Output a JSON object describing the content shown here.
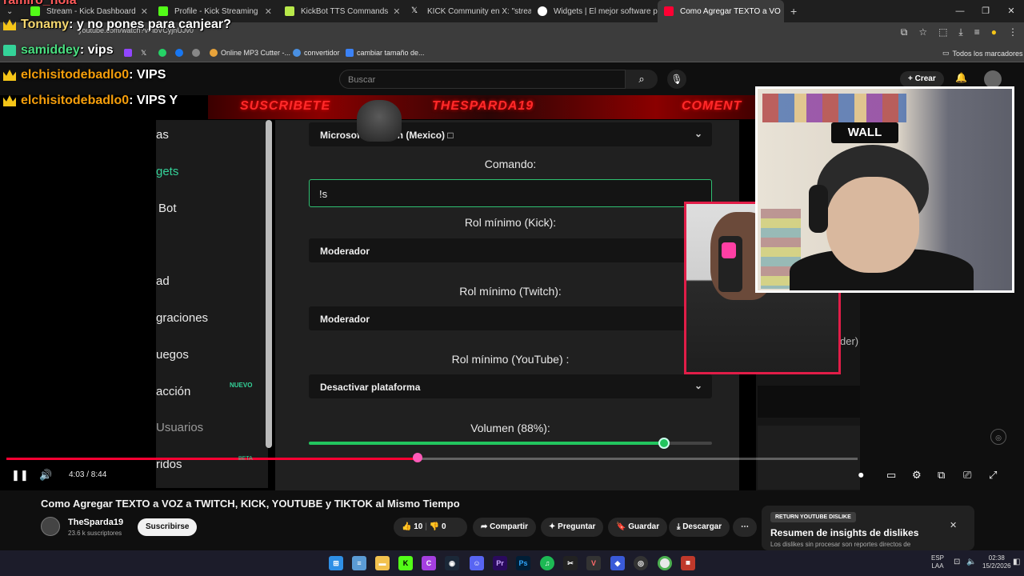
{
  "browser": {
    "tabs": [
      {
        "label": "Stream - Kick Dashboard",
        "color": "#53fc18"
      },
      {
        "label": "Profile - Kick Streaming",
        "color": "#53fc18"
      },
      {
        "label": "KickBot TTS Commands",
        "color": "#b8e94a"
      },
      {
        "label": "KICK Community en X: \"stream",
        "color": "#ffffff"
      },
      {
        "label": "Widgets | El mejor software pa",
        "color": "#ffffff"
      },
      {
        "label": "Como Agregar TEXTO a VO",
        "color": "#ff0033"
      }
    ],
    "url": "youtube.com/watch?v=lbVCyjhUJv0",
    "bookmarks": {
      "mp3": "Online MP3 Cutter -...",
      "convertidor": "convertidor",
      "resize": "cambiar tamaño de...",
      "all": "Todos los marcadores"
    }
  },
  "yt_header": {
    "search_placeholder": "Buscar",
    "create": "Crear"
  },
  "chat": [
    {
      "user": "ramiro_hola",
      "message": ""
    },
    {
      "user": "Tonamy",
      "message": ": y no pones para canjear?"
    },
    {
      "user": "samiddey",
      "message": ": vips"
    },
    {
      "user": "elchisitodebadlo0",
      "message": ": VIPS"
    },
    {
      "user": "elchisitodebadlo0",
      "message": ": VIPS Y"
    }
  ],
  "banner": {
    "left": "SUSCRIBETE",
    "center": "THESPARDA19",
    "right": "COMENT"
  },
  "sidebar": {
    "items": [
      "as",
      "gets",
      "Bot",
      "ad",
      "graciones",
      "uegos",
      "acción",
      "Usuarios",
      "ridos"
    ],
    "nuevo": "NUEVO",
    "beta": "BETA"
  },
  "form": {
    "voice": "Microsoft           Spanish (Mexico) □",
    "command_label": "Comando:",
    "command_value": "!s",
    "rol_kick_label": "Rol mínimo (Kick):",
    "rol_kick_value": "Moderador",
    "rol_twitch_label": "Rol mínimo (Twitch):",
    "rol_twitch_value": "Moderador",
    "rol_youtube_label": "Rol mínimo (YouTube) :",
    "rol_youtube_value": "Desactivar plataforma",
    "volume_label": "Volumen (88%):",
    "volume": 0.88
  },
  "cam": {
    "wall_text": "WALL"
  },
  "right_panel": {
    "der": "der)"
  },
  "player": {
    "time": "4:03 / 8:44",
    "progress": 0.483
  },
  "video_info": {
    "title": "Como Agregar TEXTO a VOZ a TWITCH, KICK, YOUTUBE y TIKTOK al Mismo Tiempo",
    "channel": "TheSparda19",
    "subscribers": "23.6 k suscriptores",
    "subscribe": "Suscribirse",
    "likes": "10",
    "dislikes": "0",
    "share": "Compartir",
    "ask": "Preguntar",
    "save": "Guardar",
    "download": "Descargar"
  },
  "ryd": {
    "tag": "RETURN YOUTUBE DISLIKE",
    "title": "Resumen de insights de dislikes",
    "subtitle": "Los dislikes sin procesar son reportes directos de"
  },
  "taskbar": {
    "lang1": "ESP",
    "lang2": "LAA",
    "time": "02:38",
    "date": "15/2/2026"
  }
}
